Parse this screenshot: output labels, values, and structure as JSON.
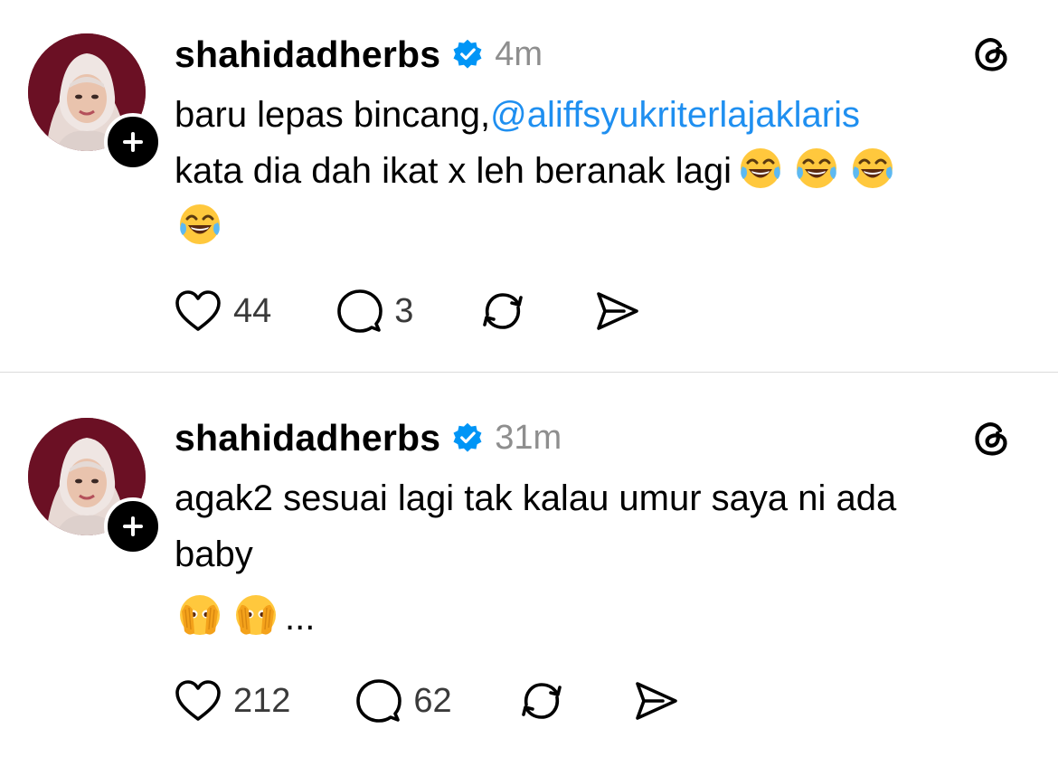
{
  "posts": [
    {
      "username": "shahidadherbs",
      "timestamp": "4m",
      "text_line1_plain": "baru lepas bincang,",
      "mention": "@aliffsyukriterlajaklaris",
      "text_line2": "kata dia dah ikat x leh beranak lagi",
      "emoji_line2": [
        "face-with-tears-of-joy",
        "face-with-tears-of-joy",
        "face-with-tears-of-joy"
      ],
      "emoji_line3": [
        "face-with-tears-of-joy"
      ],
      "likes": "44",
      "replies": "3"
    },
    {
      "username": "shahidadherbs",
      "timestamp": "31m",
      "text_line1": "agak2 sesuai lagi tak kalau umur saya ni ada",
      "text_line2": "baby",
      "emoji_line3": [
        "face-with-open-eyes-and-hand-over-mouth",
        "face-with-open-eyes-and-hand-over-mouth"
      ],
      "text_line3_suffix": "...",
      "likes": "212",
      "replies": "62"
    }
  ],
  "icons": {
    "verified": "verified-badge-icon",
    "threads": "threads-logo-icon",
    "follow": "plus-icon",
    "like": "heart-icon",
    "reply": "comment-icon",
    "repost": "repost-icon",
    "share": "share-icon"
  },
  "colors": {
    "mention": "#1f8ff0",
    "verified": "#0095f6",
    "timestamp": "#8e8e8e",
    "divider": "#dbdbdb"
  }
}
